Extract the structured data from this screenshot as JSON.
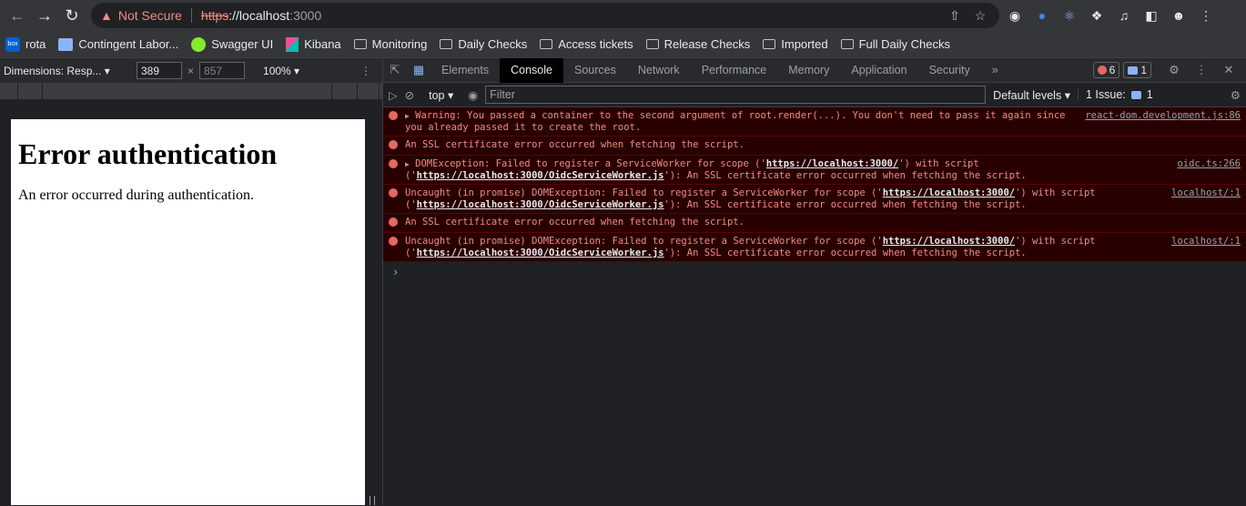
{
  "browser": {
    "not_secure_label": "Not Secure",
    "url_protocol": "https",
    "url_host": "://localhost",
    "url_port": ":3000"
  },
  "bookmarks": [
    {
      "label": "rota",
      "icon": "box-logo"
    },
    {
      "label": "Contingent Labor...",
      "icon": "contingent-labor-logo"
    },
    {
      "label": "Swagger UI",
      "icon": "swagger-logo"
    },
    {
      "label": "Kibana",
      "icon": "kibana-logo"
    },
    {
      "label": "Monitoring",
      "icon": "folder-icon"
    },
    {
      "label": "Daily Checks",
      "icon": "folder-icon"
    },
    {
      "label": "Access tickets",
      "icon": "folder-icon"
    },
    {
      "label": "Release Checks",
      "icon": "folder-icon"
    },
    {
      "label": "Imported",
      "icon": "folder-icon"
    },
    {
      "label": "Full Daily Checks",
      "icon": "folder-icon"
    }
  ],
  "device_toolbar": {
    "dimensions_label": "Dimensions: Resp...",
    "width": "389",
    "height": "857",
    "zoom": "100%"
  },
  "page": {
    "heading": "Error authentication",
    "body": "An error occurred during authentication."
  },
  "devtools": {
    "tabs": [
      "Elements",
      "Console",
      "Sources",
      "Network",
      "Performance",
      "Memory",
      "Application",
      "Security"
    ],
    "active_tab": "Console",
    "more_label": "»",
    "error_count": "6",
    "message_count": "1",
    "context": "top",
    "filter_placeholder": "Filter",
    "levels_label": "Default levels",
    "issues_label": "1 Issue:",
    "issues_count": "1"
  },
  "console": {
    "messages": [
      {
        "expandable": true,
        "parts": [
          "Warning: You passed a container to the second argument of root.render(...). You don't need to pass it again since you already passed it to create the root."
        ],
        "source": "react-dom.development.js:86"
      },
      {
        "expandable": false,
        "parts": [
          "An SSL certificate error occurred when fetching the script."
        ],
        "source": ""
      },
      {
        "expandable": true,
        "pre": "DOMException: Failed to register a ServiceWorker for scope ('",
        "link1": "https://localhost:3000/",
        "mid": "') with script ('",
        "link2": "https://localhost:3000/OidcServiceWorker.js",
        "post": "'): An SSL certificate error occurred when fetching the script.",
        "source": "oidc.ts:266"
      },
      {
        "expandable": false,
        "pre": "Uncaught (in promise) DOMException: Failed to register a ServiceWorker for scope ('",
        "link1": "https://localhost:3000/",
        "mid": "') with script ('",
        "link2": "https://localhost:3000/OidcServiceWorker.js",
        "post": "'): An SSL certificate error occurred when fetching the script.",
        "source": "localhost/:1"
      },
      {
        "expandable": false,
        "parts": [
          "An SSL certificate error occurred when fetching the script."
        ],
        "source": ""
      },
      {
        "expandable": false,
        "pre": "Uncaught (in promise) DOMException: Failed to register a ServiceWorker for scope ('",
        "link1": "https://localhost:3000/",
        "mid": "') with script ('",
        "link2": "https://localhost:3000/OidcServiceWorker.js",
        "post": "'): An SSL certificate error occurred when fetching the script.",
        "source": "localhost/:1"
      }
    ],
    "prompt": "›"
  },
  "colors": {
    "error_text": "#f28b82",
    "error_bg": "#290000",
    "accent": "#8ab4f8"
  }
}
